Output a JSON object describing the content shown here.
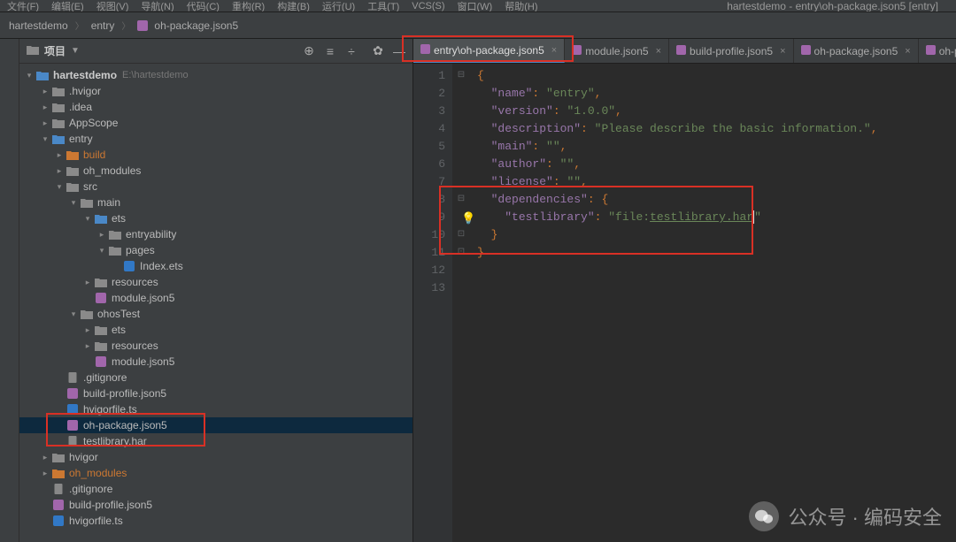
{
  "window_title": "hartestdemo - entry\\oh-package.json5 [entry]",
  "menu": [
    "文件(F)",
    "编辑(E)",
    "视图(V)",
    "导航(N)",
    "代码(C)",
    "重构(R)",
    "构建(B)",
    "运行(U)",
    "工具(T)",
    "VCS(S)",
    "窗口(W)",
    "帮助(H)"
  ],
  "breadcrumb": [
    "hartestdemo",
    "entry",
    "oh-package.json5"
  ],
  "sidebar": {
    "header": "项目",
    "root": {
      "name": "hartestdemo",
      "path": "E:\\hartestdemo"
    },
    "items": [
      {
        "indent": 1,
        "chev": ">",
        "icon": "folder",
        "name": ".hvigor"
      },
      {
        "indent": 1,
        "chev": ">",
        "icon": "folder",
        "name": ".idea"
      },
      {
        "indent": 1,
        "chev": ">",
        "icon": "folder",
        "name": "AppScope"
      },
      {
        "indent": 1,
        "chev": "v",
        "icon": "folder-blue",
        "name": "entry"
      },
      {
        "indent": 2,
        "chev": ">",
        "icon": "folder-orange",
        "name": "build",
        "class": "orange"
      },
      {
        "indent": 2,
        "chev": ">",
        "icon": "folder",
        "name": "oh_modules"
      },
      {
        "indent": 2,
        "chev": "v",
        "icon": "folder",
        "name": "src"
      },
      {
        "indent": 3,
        "chev": "v",
        "icon": "folder",
        "name": "main"
      },
      {
        "indent": 4,
        "chev": "v",
        "icon": "folder-blue",
        "name": "ets"
      },
      {
        "indent": 5,
        "chev": ">",
        "icon": "folder",
        "name": "entryability"
      },
      {
        "indent": 5,
        "chev": "v",
        "icon": "folder",
        "name": "pages"
      },
      {
        "indent": 6,
        "chev": "",
        "icon": "ets",
        "name": "Index.ets"
      },
      {
        "indent": 4,
        "chev": ">",
        "icon": "folder",
        "name": "resources"
      },
      {
        "indent": 4,
        "chev": "",
        "icon": "json",
        "name": "module.json5"
      },
      {
        "indent": 3,
        "chev": "v",
        "icon": "folder",
        "name": "ohosTest"
      },
      {
        "indent": 4,
        "chev": ">",
        "icon": "folder",
        "name": "ets"
      },
      {
        "indent": 4,
        "chev": ">",
        "icon": "folder",
        "name": "resources"
      },
      {
        "indent": 4,
        "chev": "",
        "icon": "json",
        "name": "module.json5"
      },
      {
        "indent": 2,
        "chev": "",
        "icon": "file",
        "name": ".gitignore"
      },
      {
        "indent": 2,
        "chev": "",
        "icon": "json",
        "name": "build-profile.json5"
      },
      {
        "indent": 2,
        "chev": "",
        "icon": "ts",
        "name": "hvigorfile.ts"
      },
      {
        "indent": 2,
        "chev": "",
        "icon": "json",
        "name": "oh-package.json5",
        "selected": true
      },
      {
        "indent": 2,
        "chev": "",
        "icon": "file",
        "name": "testlibrary.har"
      },
      {
        "indent": 1,
        "chev": ">",
        "icon": "folder",
        "name": "hvigor"
      },
      {
        "indent": 1,
        "chev": ">",
        "icon": "folder-orange",
        "name": "oh_modules",
        "class": "orange"
      },
      {
        "indent": 1,
        "chev": "",
        "icon": "file",
        "name": ".gitignore"
      },
      {
        "indent": 1,
        "chev": "",
        "icon": "json",
        "name": "build-profile.json5"
      },
      {
        "indent": 1,
        "chev": "",
        "icon": "ts",
        "name": "hvigorfile.ts"
      }
    ]
  },
  "editor_tabs": [
    {
      "label": "entry\\oh-package.json5",
      "active": true
    },
    {
      "label": "module.json5",
      "active": false
    },
    {
      "label": "build-profile.json5",
      "active": false
    },
    {
      "label": "oh-package.json5",
      "active": false
    },
    {
      "label": "oh-p",
      "active": false,
      "truncated": true
    }
  ],
  "code": {
    "lines": {
      "1": "{",
      "2k": "\"name\"",
      "2v": "\"entry\"",
      "3k": "\"version\"",
      "3v": "\"1.0.0\"",
      "4k": "\"description\"",
      "4v": "\"Please describe the basic information.\"",
      "5k": "\"main\"",
      "5v": "\"\"",
      "6k": "\"author\"",
      "6v": "\"\"",
      "7k": "\"license\"",
      "7v": "\"\"",
      "8k": "\"dependencies\"",
      "9k": "\"testlibrary\"",
      "9v1": "\"file:",
      "9v2": "testlibrary.har",
      "9v3": "\"",
      "10": "}",
      "11": "}"
    },
    "max_line": 13
  },
  "watermark": "公众号 · 编码安全"
}
